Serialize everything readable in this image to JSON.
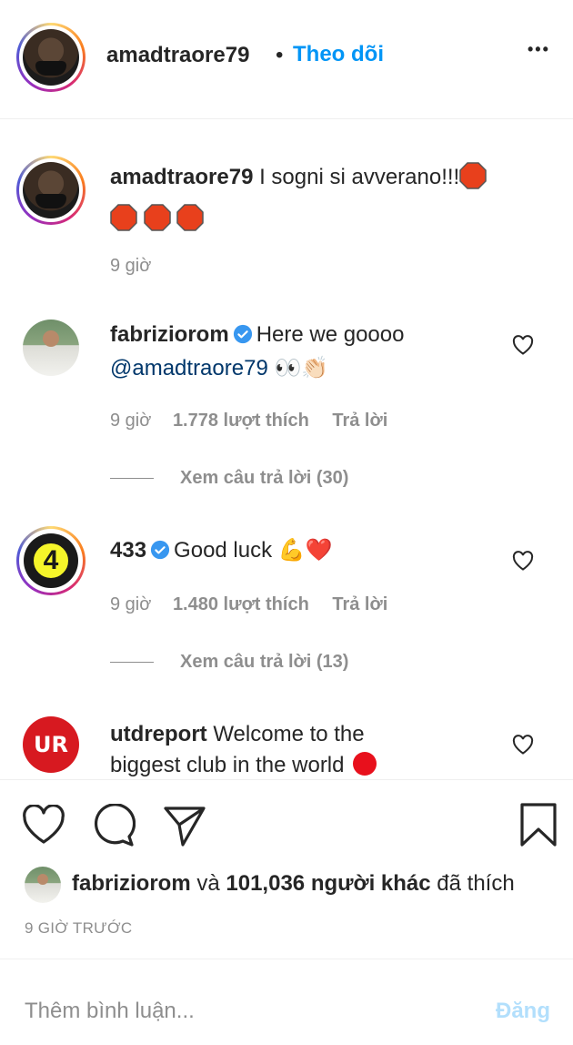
{
  "header": {
    "username": "amadtraore79",
    "separator": "•",
    "follow_label": "Theo dõi",
    "more_label": "•••"
  },
  "caption": {
    "username": "amadtraore79",
    "text": "I sogni si avverano!!!",
    "time": "9 giờ"
  },
  "comments": [
    {
      "username": "fabriziorom",
      "verified": true,
      "text": "Here we goooo",
      "mention": "@amadtraore79",
      "emoji": "👀👏🏻",
      "time": "9 giờ",
      "likes": "1.778 lượt thích",
      "reply_label": "Trả lời",
      "view_replies": "Xem câu trả lời (30)"
    },
    {
      "username": "433",
      "verified": true,
      "text": "Good luck",
      "emoji": "💪❤️",
      "time": "9 giờ",
      "likes": "1.480 lượt thích",
      "reply_label": "Trả lời",
      "view_replies": "Xem câu trả lời (13)",
      "avatar_text": "4"
    },
    {
      "username": "utdreport",
      "verified": false,
      "text": "Welcome to the biggest club in the world",
      "avatar_text": "UR"
    }
  ],
  "likes_summary": {
    "liker": "fabriziorom",
    "middle": "và",
    "count": "101,036 người khác",
    "suffix": "đã thích"
  },
  "timestamp": "9 GIỜ TRƯỚC",
  "comment_box": {
    "placeholder": "Thêm bình luận...",
    "post_label": "Đăng"
  },
  "colors": {
    "accent": "#0095f6",
    "verified": "#3897f0",
    "stop_red": "#e8401c",
    "muted": "#8e8e8e"
  }
}
